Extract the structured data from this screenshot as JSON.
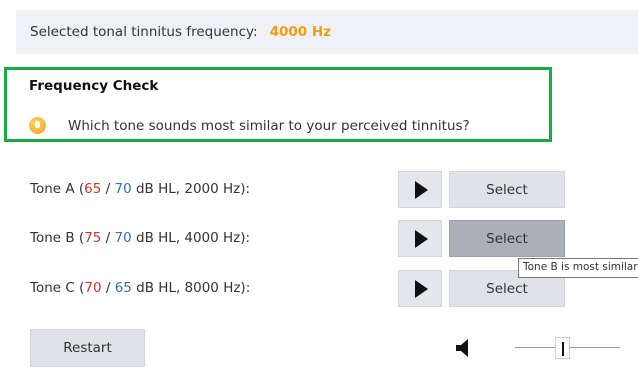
{
  "header": {
    "label": "Selected tonal tinnitus frequency:",
    "frequency": "4000 Hz"
  },
  "frequency_check": {
    "title": "Frequency Check",
    "question": "Which tone sounds most similar to your perceived tinnitus?",
    "icon": "hand-icon"
  },
  "tones": [
    {
      "prefix": "Tone A (",
      "level_left": "65",
      "sep": " / ",
      "level_right": "70",
      "suffix": " dB HL, 2000 Hz):",
      "select_label": "Select"
    },
    {
      "prefix": "Tone B (",
      "level_left": "75",
      "sep": " / ",
      "level_right": "70",
      "suffix": " dB HL, 4000 Hz):",
      "select_label": "Select"
    },
    {
      "prefix": "Tone C (",
      "level_left": "70",
      "sep": " / ",
      "level_right": "65",
      "suffix": " dB HL, 8000 Hz):",
      "select_label": "Select"
    }
  ],
  "tooltip": {
    "text": "Tone B is most similar"
  },
  "restart_label": "Restart",
  "volume": {
    "level": 0.45
  },
  "colors": {
    "accent_orange": "#f39c12",
    "frame_green": "#1ba945",
    "left_ear_red": "#c0392b",
    "right_ear_blue": "#2e6fb8"
  }
}
